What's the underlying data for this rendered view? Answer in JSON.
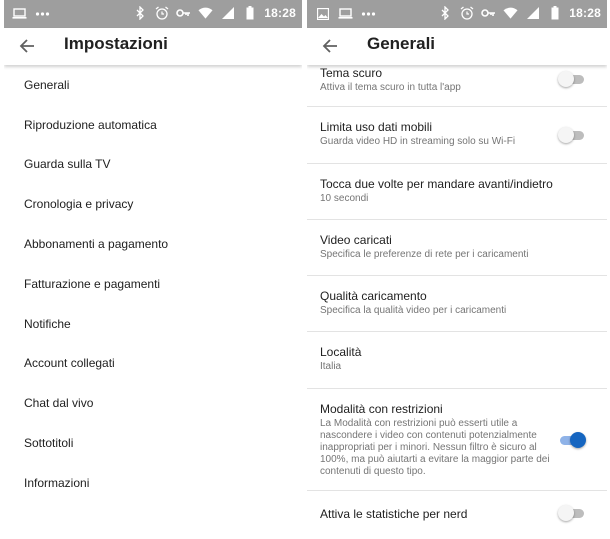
{
  "status_bar": {
    "time": "18:28"
  },
  "left": {
    "title": "Impostazioni",
    "items": [
      "Generali",
      "Riproduzione automatica",
      "Guarda sulla TV",
      "Cronologia e privacy",
      "Abbonamenti a pagamento",
      "Fatturazione e pagamenti",
      "Notifiche",
      "Account collegati",
      "Chat dal vivo",
      "Sottotitoli",
      "Informazioni"
    ]
  },
  "right": {
    "title": "Generali",
    "settings": [
      {
        "title": "Tema scuro",
        "subtitle": "Attiva il tema scuro in tutta l'app",
        "toggle": "off"
      },
      {
        "title": "Limita uso dati mobili",
        "subtitle": "Guarda video HD in streaming solo su Wi-Fi",
        "toggle": "off"
      },
      {
        "title": "Tocca due volte per mandare avanti/indietro",
        "subtitle": "10 secondi"
      },
      {
        "title": "Video caricati",
        "subtitle": "Specifica le preferenze di rete per i caricamenti"
      },
      {
        "title": "Qualità caricamento",
        "subtitle": "Specifica la qualità video per i caricamenti"
      },
      {
        "title": "Località",
        "subtitle": "Italia"
      },
      {
        "title": "Modalità con restrizioni",
        "subtitle": "La Modalità con restrizioni può esserti utile a nascondere i video con contenuti potenzialmente inappropriati per i minori. Nessun filtro è sicuro al 100%, ma può aiutarti a evitare la maggior parte dei contenuti di questo tipo.",
        "toggle": "on"
      },
      {
        "title": "Attiva le statistiche per nerd",
        "toggle": "off"
      }
    ]
  },
  "colors": {
    "status_bar": "#9e9e9e",
    "toggle_on": "#1565c0",
    "toggle_off_track": "#bdbdbd"
  },
  "icons": [
    "laptop-icon",
    "dots-icon",
    "image-icon",
    "bluetooth-icon",
    "alarm-icon",
    "key-icon",
    "wifi-icon",
    "signal-icon",
    "battery-icon",
    "back-arrow-icon"
  ]
}
